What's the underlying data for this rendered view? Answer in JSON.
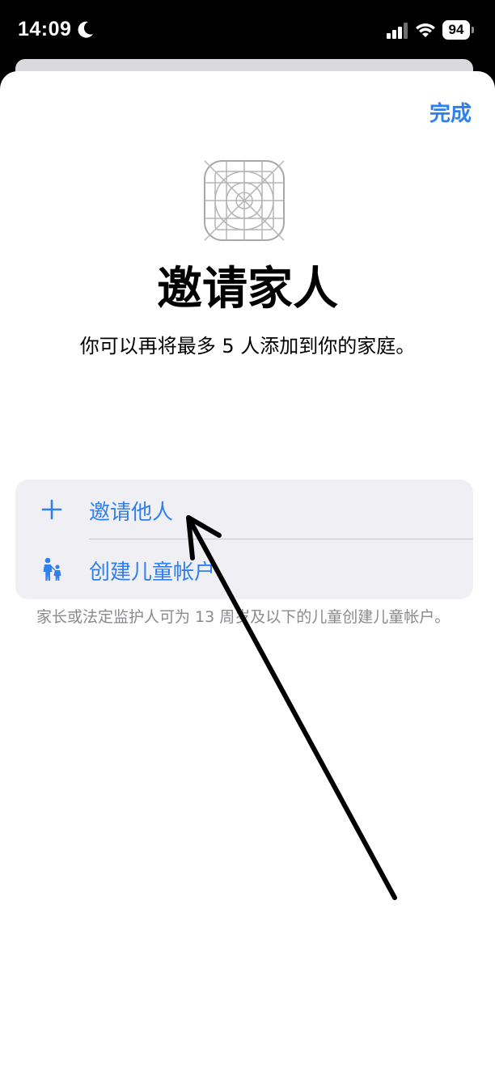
{
  "status_bar": {
    "time": "14:09",
    "battery": "94",
    "icons": [
      "moon-icon",
      "signal-icon",
      "wifi-icon",
      "battery-icon"
    ]
  },
  "sheet": {
    "done_label": "完成",
    "app_icon": "placeholder-app-icon",
    "title": "邀请家人",
    "subtitle": "你可以再将最多 5 人添加到你的家庭。"
  },
  "options": [
    {
      "label": "邀请他人",
      "icon": "plus-icon"
    },
    {
      "label": "创建儿童帐户",
      "icon": "parent-child-icon"
    }
  ],
  "footnote": "家长或法定监护人可为 13 周岁及以下的儿童创建儿童帐户。",
  "annotation": {
    "icon": "arrow-annotation"
  },
  "colors": {
    "accent": "#2f80ed",
    "card_bg": "#f0f0f4",
    "footnote": "#8a8a8e"
  }
}
